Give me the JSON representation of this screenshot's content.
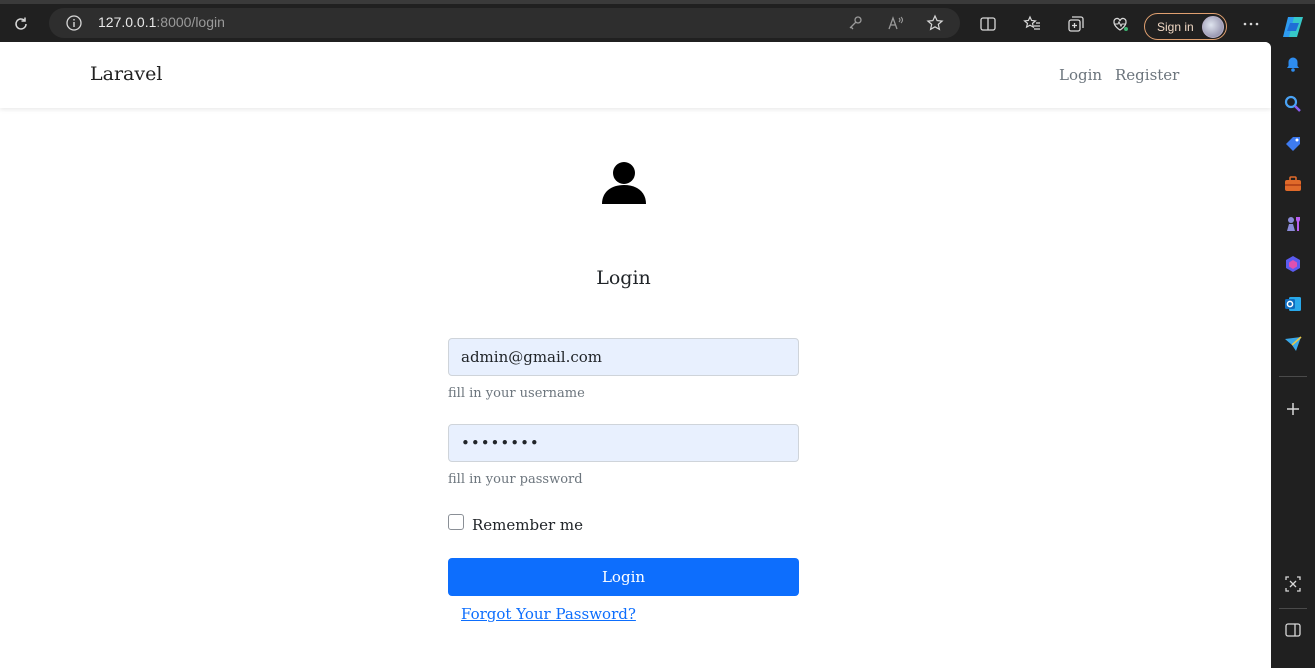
{
  "browser": {
    "url_host": "127.0.0.1",
    "url_rest": ":8000/login",
    "signin_label": "Sign in"
  },
  "navbar": {
    "brand": "Laravel",
    "links": [
      "Login",
      "Register"
    ]
  },
  "login": {
    "title": "Login",
    "email_value": "admin@gmail.com",
    "email_help": "fill in your username",
    "password_value": "••••••••",
    "password_help": "fill in your password",
    "remember_label": "Remember me",
    "remember_checked": false,
    "submit_label": "Login",
    "forgot_label": "Forgot Your Password?"
  },
  "colors": {
    "primary": "#0d6efd",
    "field_bg": "#e8f0fe",
    "muted": "#6c757d"
  }
}
